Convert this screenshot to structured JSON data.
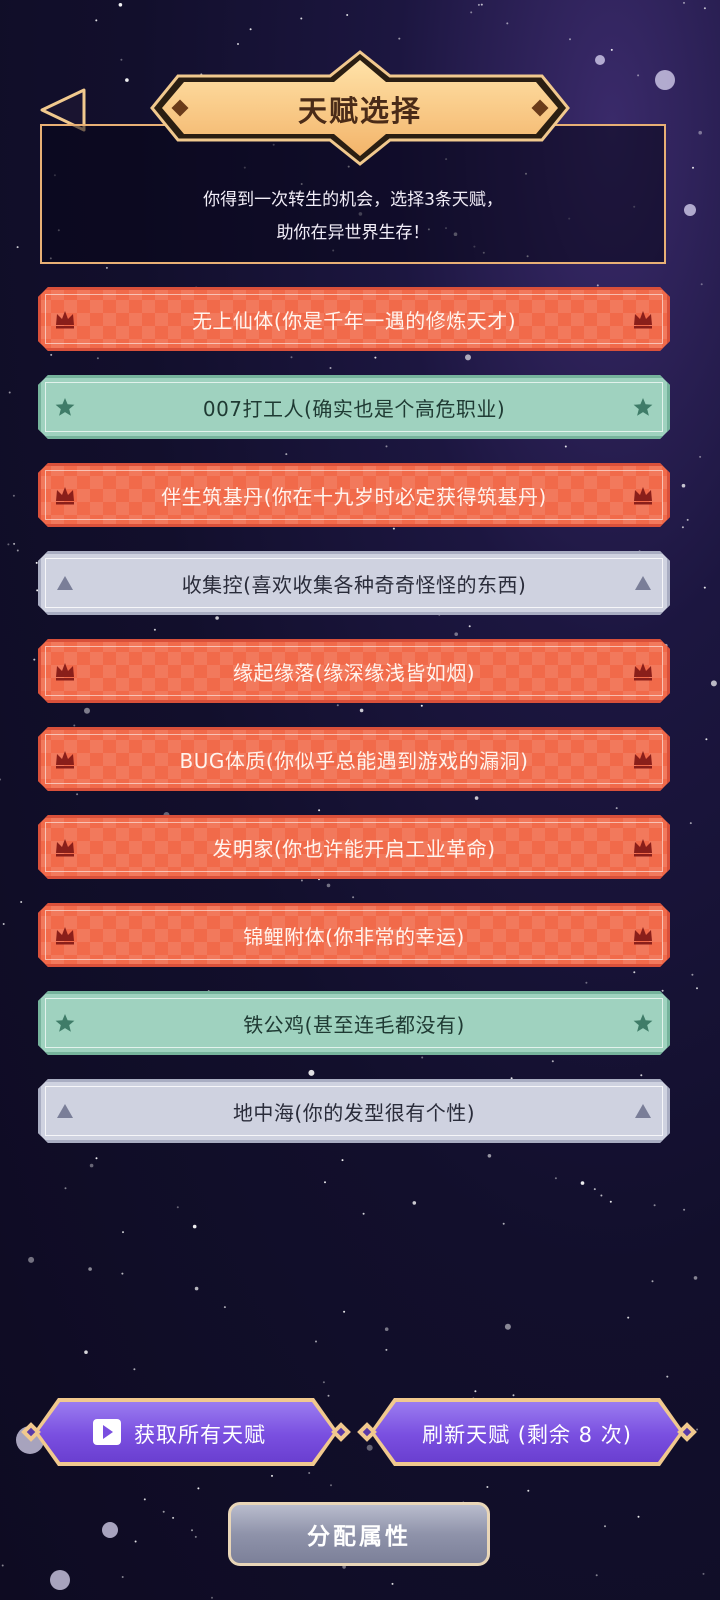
{
  "header": {
    "title": "天赋选择",
    "intro_line1": "你得到一次转生的机会，选择3条天赋，",
    "intro_line2": "助你在异世界生存！"
  },
  "talents": [
    {
      "label": "无上仙体(你是千年一遇的修炼天才)",
      "tier": "red",
      "icon": "crown-icon"
    },
    {
      "label": "007打工人(确实也是个高危职业)",
      "tier": "green",
      "icon": "star-icon"
    },
    {
      "label": "伴生筑基丹(你在十九岁时必定获得筑基丹)",
      "tier": "red",
      "icon": "crown-icon"
    },
    {
      "label": "收集控(喜欢收集各种奇奇怪怪的东西)",
      "tier": "gray",
      "icon": "triangle-icon"
    },
    {
      "label": "缘起缘落(缘深缘浅皆如烟)",
      "tier": "red",
      "icon": "crown-icon"
    },
    {
      "label": "BUG体质(你似乎总能遇到游戏的漏洞)",
      "tier": "red",
      "icon": "crown-icon"
    },
    {
      "label": "发明家(你也许能开启工业革命)",
      "tier": "red",
      "icon": "crown-icon"
    },
    {
      "label": "锦鲤附体(你非常的幸运)",
      "tier": "red",
      "icon": "crown-icon"
    },
    {
      "label": "铁公鸡(甚至连毛都没有)",
      "tier": "green",
      "icon": "star-icon"
    },
    {
      "label": "地中海(你的发型很有个性)",
      "tier": "gray",
      "icon": "triangle-icon"
    }
  ],
  "buttons": {
    "get_all": "获取所有天赋",
    "refresh": "刷新天赋 (剩余 8 次)",
    "assign": "分配属性"
  },
  "colors": {
    "red": "#f16a4a",
    "green": "#9fd2bf",
    "gray": "#cfd2e0",
    "purple": "#7a4fe0",
    "gold": "#f1c98e"
  }
}
